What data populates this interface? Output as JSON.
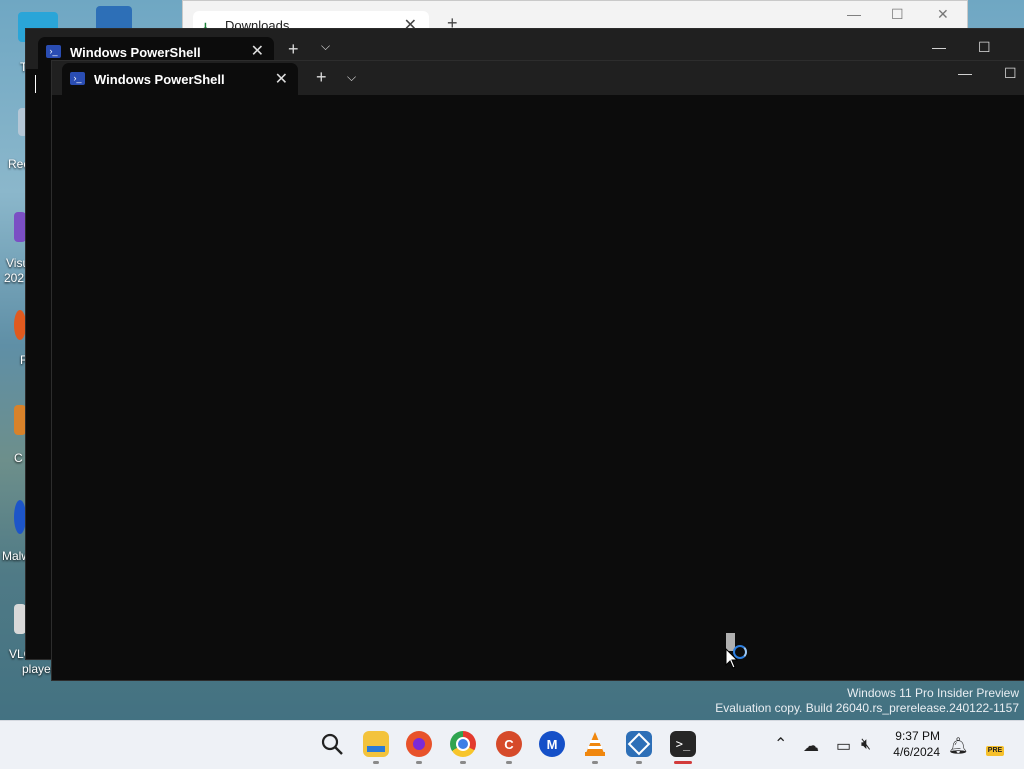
{
  "desktop": {
    "icons": [
      {
        "label": "T",
        "name": "desktop-icon-t",
        "color": "#2aa5d8"
      },
      {
        "label": "Rec",
        "name": "desktop-icon-recycle",
        "color": "#b5c7d6"
      },
      {
        "label": "Visu",
        "name": "desktop-icon-visual-studio",
        "color": "#7b4fc4"
      },
      {
        "label": "202",
        "name": "desktop-icon-visual-studio-year",
        "color": ""
      },
      {
        "label": "F",
        "name": "desktop-icon-firefox",
        "color": "#e05a1f"
      },
      {
        "label": "C",
        "name": "desktop-icon-ccleaner",
        "color": "#d8822a"
      },
      {
        "label": "Malw",
        "name": "desktop-icon-malwarebytes",
        "color": "#1d55c8"
      },
      {
        "label": "VLC me",
        "name": "desktop-icon-vlc",
        "color": "#d9d9d9"
      },
      {
        "label": "player",
        "name": "desktop-icon-vlc-line2",
        "color": ""
      }
    ]
  },
  "explorer": {
    "tab_label": "Downloads",
    "tab_icon": "download-arrow-icon",
    "close_glyph": "✕",
    "add_glyph": "+",
    "minimize_glyph": "—",
    "maximize_glyph": "☐",
    "window_close_glyph": "✕"
  },
  "terminal_back": {
    "tab_title": "Windows PowerShell",
    "close_glyph": "✕",
    "add_glyph": "+",
    "dropdown_glyph": "⌵",
    "minimize_glyph": "—",
    "maximize_glyph": "☐"
  },
  "terminal_front": {
    "tab_title": "Windows PowerShell",
    "ps_icon_glyph": "›_",
    "close_glyph": "✕",
    "add_glyph": "+",
    "dropdown_glyph": "⌵",
    "minimize_glyph": "—",
    "maximize_glyph": "☐"
  },
  "watermark": {
    "line1": "Windows 11 Pro Insider Preview",
    "line2": "Evaluation copy. Build 26040.rs_prerelease.240122-1157"
  },
  "taskbar": {
    "apps": [
      {
        "name": "search-icon",
        "glyph": "⚲",
        "bg": "transparent",
        "fg": "#222"
      },
      {
        "name": "file-explorer-icon",
        "glyph": "▬",
        "bg": "#f3c33c",
        "fg": "#2b7ad6"
      },
      {
        "name": "firefox-icon",
        "glyph": "●",
        "bg": "#e8522a",
        "fg": "#7b2ad6"
      },
      {
        "name": "chrome-icon",
        "glyph": "◉",
        "bg": "#36a852",
        "fg": "#fff"
      },
      {
        "name": "ccleaner-icon",
        "glyph": "C",
        "bg": "#d64a2a",
        "fg": "#fff"
      },
      {
        "name": "malwarebytes-icon",
        "glyph": "M",
        "bg": "#1550c8",
        "fg": "#fff"
      },
      {
        "name": "vlc-icon",
        "glyph": "▲",
        "bg": "transparent",
        "fg": "#f0870e"
      },
      {
        "name": "virtualbox-icon",
        "glyph": "⬡",
        "bg": "#2d6fb7",
        "fg": "#fff"
      },
      {
        "name": "terminal-icon",
        "glyph": ">_",
        "bg": "#262626",
        "fg": "#fff"
      }
    ],
    "tray": {
      "chevron_glyph": "^",
      "onedrive_glyph": "☁",
      "display_glyph": "▭",
      "volume_glyph": "✕"
    },
    "clock": {
      "time": "9:37 PM",
      "date": "4/6/2024"
    },
    "notification_glyph": "🔔",
    "pre_badge": "PRE"
  }
}
